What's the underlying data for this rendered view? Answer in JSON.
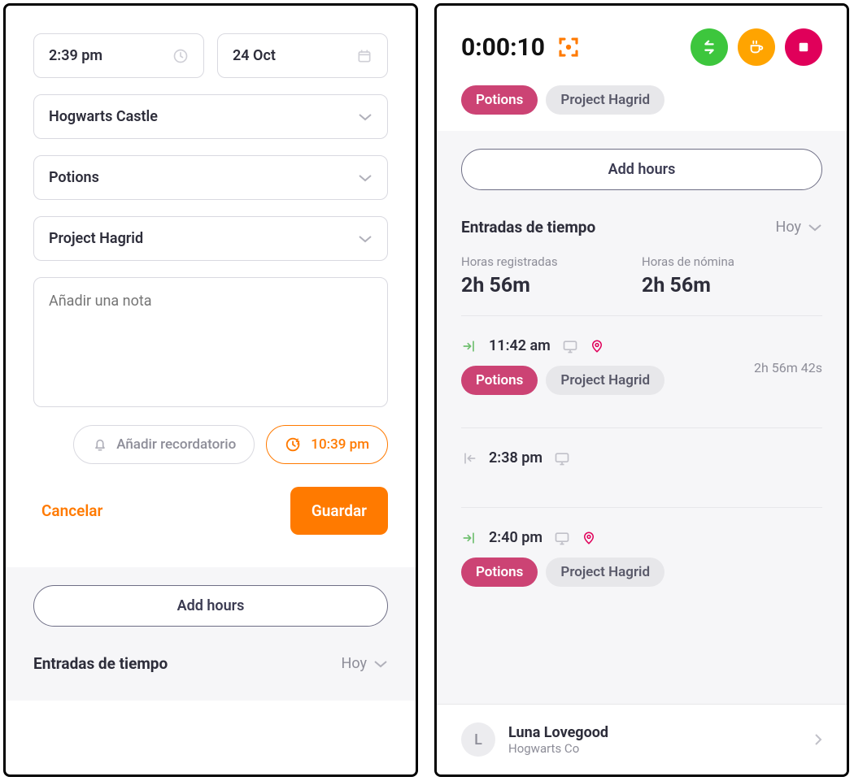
{
  "left": {
    "time_value": "2:39 pm",
    "date_value": "24 Oct",
    "location": "Hogwarts Castle",
    "category": "Potions",
    "project": "Project Hagrid",
    "note_placeholder": "Añadir una nota",
    "reminder_label": "Añadir recordatorio",
    "end_time_label": "10:39 pm",
    "cancel_label": "Cancelar",
    "save_label": "Guardar",
    "addhours_label": "Add hours",
    "entries_title": "Entradas de tiempo",
    "filter_label": "Hoy"
  },
  "right": {
    "timer_value": "0:00:10",
    "tag1": "Potions",
    "tag2": "Project Hagrid",
    "addhours_label": "Add hours",
    "entries_title": "Entradas de tiempo",
    "filter_label": "Hoy",
    "stat1_label": "Horas registradas",
    "stat1_value": "2h 56m",
    "stat2_label": "Horas de nómina",
    "stat2_value": "2h 56m",
    "entries": [
      {
        "dir": "in",
        "time": "11:42 am",
        "has_loc": true,
        "dur": "2h 56m 42s",
        "tag1": "Potions",
        "tag2": "Project Hagrid"
      },
      {
        "dir": "out",
        "time": "2:38 pm",
        "has_loc": false
      },
      {
        "dir": "in",
        "time": "2:40 pm",
        "has_loc": true,
        "tag1": "Potions",
        "tag2": "Project Hagrid"
      }
    ],
    "user_initial": "L",
    "user_name": "Luna Lovegood",
    "user_org": "Hogwarts Co"
  }
}
